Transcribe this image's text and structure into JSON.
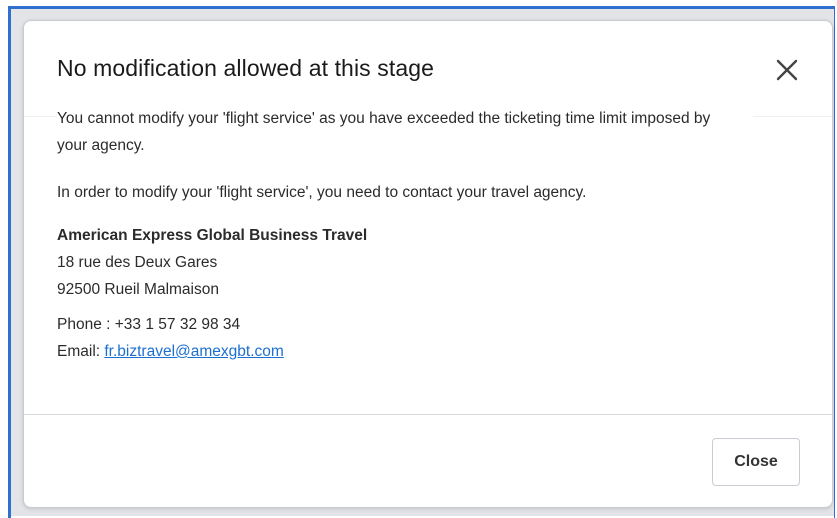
{
  "modal": {
    "title": "No modification allowed at this stage",
    "close_icon": "close-icon",
    "paragraph_1": "You cannot modify your 'flight service' as you have exceeded the ticketing time limit imposed by your agency.",
    "paragraph_2": "In order to modify your 'flight service', you need to contact your travel agency.",
    "agency": {
      "name": "American Express Global Business Travel",
      "address_line_1": "18 rue des Deux Gares",
      "address_line_2": "92500 Rueil Malmaison",
      "phone_label": "Phone : ",
      "phone": "+33 1 57 32 98 34",
      "email_label": "Email: ",
      "email": "fr.biztravel@amexgbt.com"
    },
    "close_label": "Close"
  },
  "colors": {
    "frame_border": "#2f6fcf",
    "link": "#1c6fd1",
    "title_text": "#1a1a1a",
    "body_text": "#2b2b2b"
  }
}
